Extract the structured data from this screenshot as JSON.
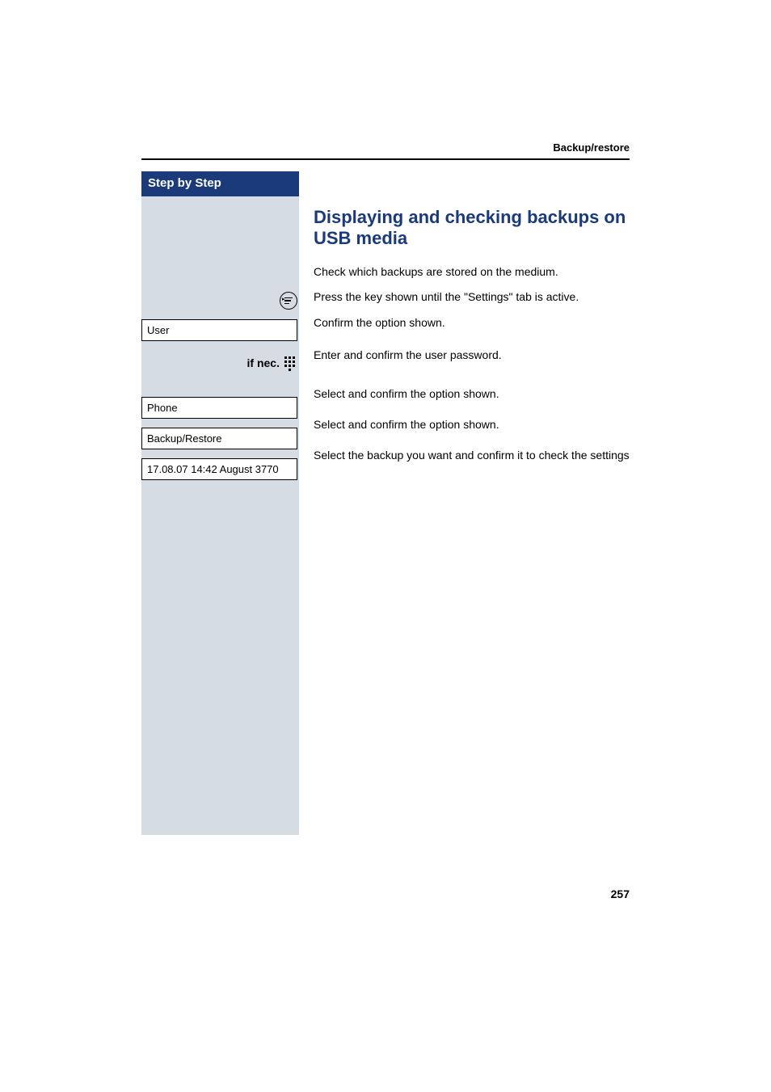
{
  "header": {
    "section": "Backup/restore"
  },
  "sidebar": {
    "title": "Step by Step"
  },
  "main": {
    "heading": "Displaying and checking backups on USB media",
    "intro": "Check which backups are stored on the medium."
  },
  "steps": [
    {
      "left_type": "icon",
      "left_icon": "settings-key",
      "right": "Press the key shown until the \"Settings\" tab is active."
    },
    {
      "left_type": "box",
      "left_text": "User",
      "right": "Confirm the option shown."
    },
    {
      "left_type": "ifnec",
      "if_label": "if nec.",
      "left_icon": "keypad-icon",
      "right": "Enter and confirm the user password."
    },
    {
      "left_type": "box",
      "left_text": "Phone",
      "right": "Select and confirm the option shown."
    },
    {
      "left_type": "box",
      "left_text": "Backup/Restore",
      "right": "Select and confirm the option shown."
    },
    {
      "left_type": "box",
      "left_text": "17.08.07 14:42 August 3770",
      "right": "Select the backup you want and confirm it to check the settings"
    }
  ],
  "page_number": "257"
}
